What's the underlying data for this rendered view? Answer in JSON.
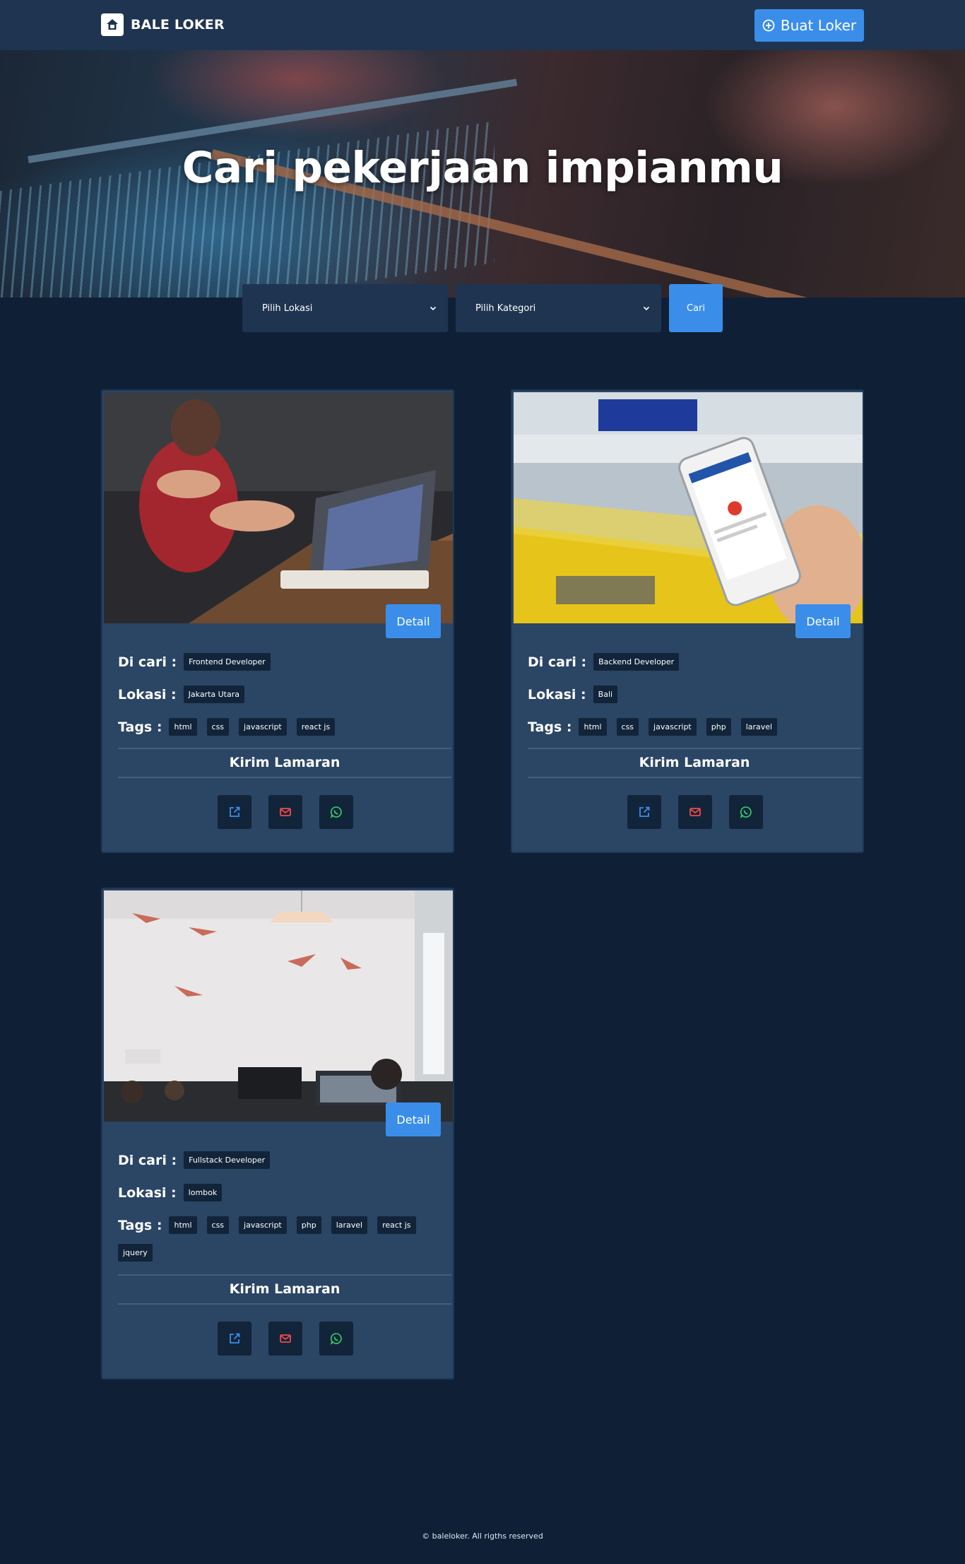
{
  "navbar": {
    "brand": "BALE LOKER",
    "create_button": "Buat Loker",
    "brand_icon": "home-bag-icon",
    "create_icon": "plus-circle-icon"
  },
  "hero": {
    "title": "Cari pekerjaan impianmu"
  },
  "search": {
    "location_placeholder": "Pilih Lokasi",
    "category_placeholder": "Pilih Kategori",
    "submit_label": "Cari"
  },
  "labels": {
    "sought": "Di cari :",
    "location": "Lokasi :",
    "tags": "Tags :",
    "apply": "Kirim Lamaran",
    "detail": "Detail"
  },
  "jobs": [
    {
      "position": "Frontend Developer",
      "location": "Jakarta Utara",
      "tags": [
        "html",
        "css",
        "javascript",
        "react js"
      ]
    },
    {
      "position": "Backend Developer",
      "location": "Bali",
      "tags": [
        "html",
        "css",
        "javascript",
        "php",
        "laravel"
      ]
    },
    {
      "position": "Fullstack Developer",
      "location": "lombok",
      "tags": [
        "html",
        "css",
        "javascript",
        "php",
        "laravel",
        "react js",
        "jquery"
      ]
    }
  ],
  "actions": {
    "link_icon": "external-link-icon",
    "email_icon": "mail-icon",
    "whatsapp_icon": "whatsapp-icon"
  },
  "colors": {
    "background": "#0f2036",
    "navbar": "#1f3450",
    "card": "#2b4564",
    "accent": "#3a8eea",
    "chip": "#12243a"
  },
  "footer": {
    "text": "© baleloker. All rigths reserved"
  }
}
